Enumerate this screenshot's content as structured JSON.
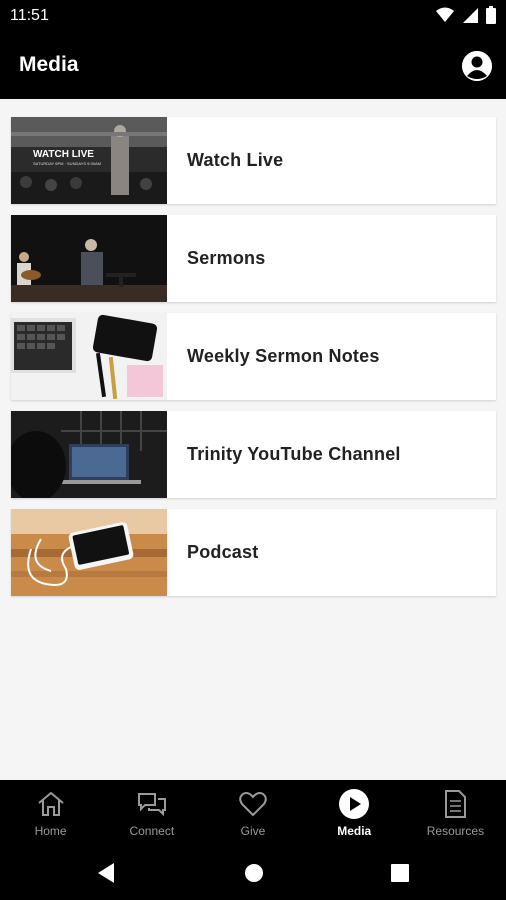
{
  "status_bar": {
    "time": "11:51",
    "icons": [
      "wifi-icon",
      "signal-icon",
      "battery-icon"
    ]
  },
  "app_bar": {
    "title": "Media",
    "profile_icon": "account-icon"
  },
  "items": [
    {
      "label": "Watch Live",
      "thumb_text": "WATCH LIVE",
      "thumb_sub": "SATURDAY 6PM · SUNDAYS 9:30AM"
    },
    {
      "label": "Sermons"
    },
    {
      "label": "Weekly Sermon Notes"
    },
    {
      "label": "Trinity YouTube Channel"
    },
    {
      "label": "Podcast"
    }
  ],
  "bottom_nav": [
    {
      "label": "Home",
      "icon": "home-icon",
      "active": false
    },
    {
      "label": "Connect",
      "icon": "chat-icon",
      "active": false
    },
    {
      "label": "Give",
      "icon": "heart-icon",
      "active": false
    },
    {
      "label": "Media",
      "icon": "play-icon",
      "active": true
    },
    {
      "label": "Resources",
      "icon": "document-icon",
      "active": false
    }
  ],
  "system_nav": [
    "back-icon",
    "home-circle-icon",
    "recents-icon"
  ],
  "colors": {
    "bar": "#000000",
    "background": "#f5f5f5",
    "inactive": "#9a9a9a",
    "active": "#ffffff"
  }
}
